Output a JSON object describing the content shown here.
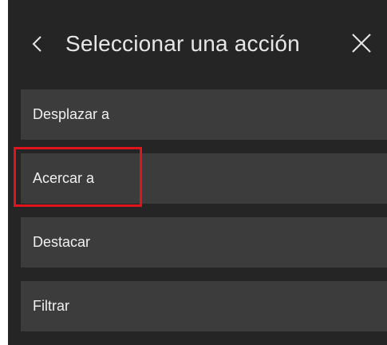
{
  "header": {
    "title": "Seleccionar una acción",
    "back_icon": "chevron-left-icon",
    "close_icon": "close-icon"
  },
  "actions": [
    {
      "label": "Desplazar a"
    },
    {
      "label": "Acercar a"
    },
    {
      "label": "Destacar"
    },
    {
      "label": "Filtrar"
    }
  ],
  "highlight": {
    "target": "Acercar a",
    "color": "#e0141c"
  },
  "colors": {
    "panel_background": "#252525",
    "item_background": "#3c3c3c",
    "text": "#f0f0f0"
  }
}
